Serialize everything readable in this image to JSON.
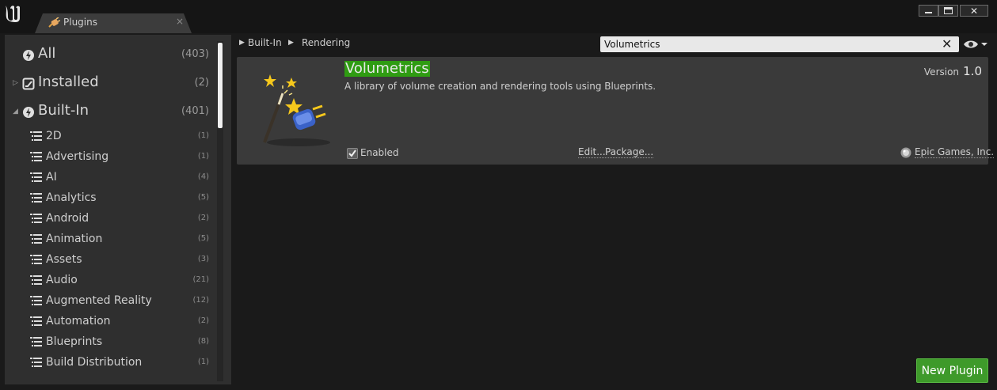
{
  "window": {
    "tab_label": "Plugins",
    "tab_close": "×",
    "close_glyph": "✕"
  },
  "sidebar": {
    "categories": [
      {
        "label": "All",
        "count": "(403)",
        "icon": "all-icon"
      },
      {
        "label": "Installed",
        "count": "(2)",
        "icon": "installed-icon"
      },
      {
        "label": "Built-In",
        "count": "(401)",
        "icon": "built-in-icon"
      }
    ],
    "subcategories": [
      {
        "label": "2D",
        "count": "(1)"
      },
      {
        "label": "Advertising",
        "count": "(1)"
      },
      {
        "label": "AI",
        "count": "(4)"
      },
      {
        "label": "Analytics",
        "count": "(5)"
      },
      {
        "label": "Android",
        "count": "(2)"
      },
      {
        "label": "Animation",
        "count": "(5)"
      },
      {
        "label": "Assets",
        "count": "(3)"
      },
      {
        "label": "Audio",
        "count": "(21)"
      },
      {
        "label": "Augmented Reality",
        "count": "(12)"
      },
      {
        "label": "Automation",
        "count": "(2)"
      },
      {
        "label": "Blueprints",
        "count": "(8)"
      },
      {
        "label": "Build Distribution",
        "count": "(1)"
      }
    ]
  },
  "breadcrumb": {
    "items": [
      "Built-In",
      "Rendering"
    ]
  },
  "search": {
    "value": "Volumetrics",
    "clear_glyph": "✕"
  },
  "plugin": {
    "name": "Volumetrics",
    "description": "A library of volume creation and rendering tools using Blueprints.",
    "version_label": "Version",
    "version_value": "1.0",
    "enabled_label": "Enabled",
    "enabled": true,
    "edit_label": "Edit...",
    "package_label": "Package...",
    "vendor": "Epic Games, Inc."
  },
  "actions": {
    "new_plugin_label": "New Plugin"
  },
  "colors": {
    "accent_green": "#3e9a2a",
    "highlight_green": "#2f9c12",
    "panel": "#2f2f2f",
    "card": "#3a3a3a"
  }
}
